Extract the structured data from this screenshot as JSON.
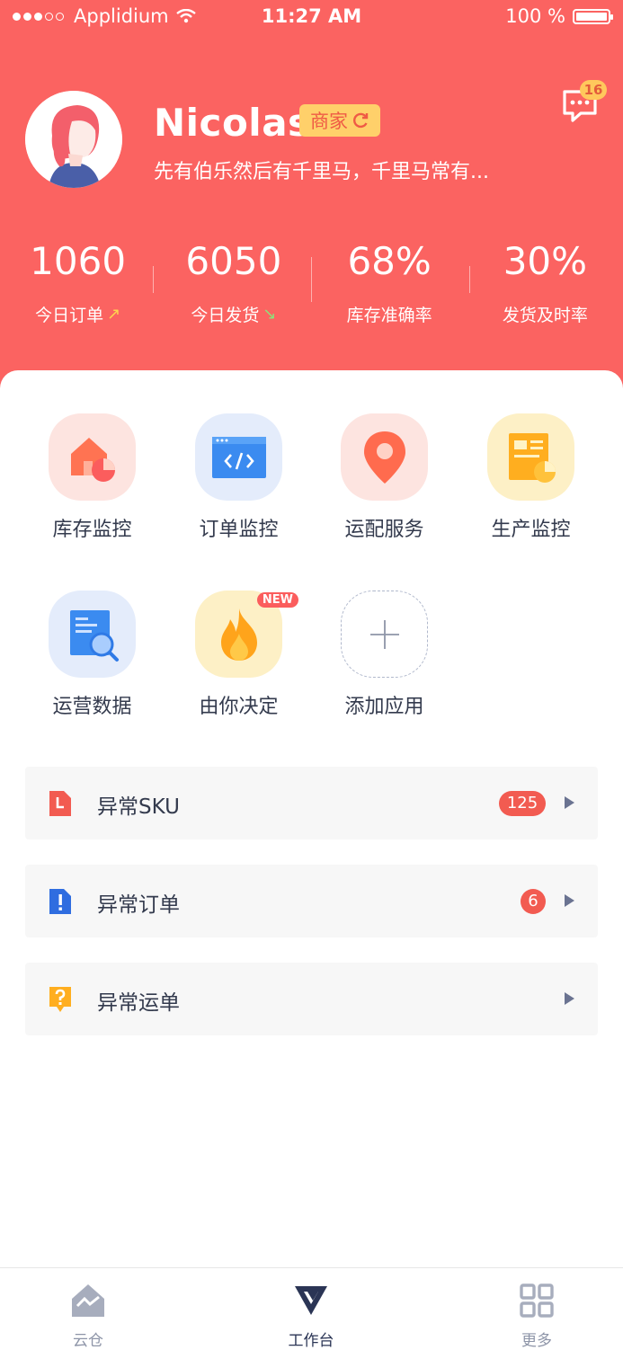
{
  "status_bar": {
    "carrier": "Applidium",
    "time": "11:27 AM",
    "battery": "100 %"
  },
  "profile": {
    "name": "Nicolas",
    "role": "商家",
    "motto": "先有伯乐然后有千里马，千里马常有...",
    "message_count": "16"
  },
  "stats": [
    {
      "value": "1060",
      "label": "今日订单",
      "trend": "up"
    },
    {
      "value": "6050",
      "label": "今日发货",
      "trend": "down"
    },
    {
      "value": "68%",
      "label": "库存准确率"
    },
    {
      "value": "30%",
      "label": "发货及时率"
    }
  ],
  "apps": [
    {
      "label": "库存监控",
      "icon": "warehouse-monitor-icon"
    },
    {
      "label": "订单监控",
      "icon": "order-monitor-icon"
    },
    {
      "label": "运配服务",
      "icon": "location-pin-icon"
    },
    {
      "label": "生产监控",
      "icon": "production-monitor-icon"
    },
    {
      "label": "运营数据",
      "icon": "data-search-icon"
    },
    {
      "label": "由你决定",
      "icon": "flame-icon",
      "badge": "NEW"
    },
    {
      "label": "添加应用",
      "icon": "plus-icon"
    }
  ],
  "alerts": [
    {
      "label": "异常SKU",
      "count": "125",
      "icon": "document-alert-icon"
    },
    {
      "label": "异常订单",
      "count": "6",
      "icon": "exclamation-doc-icon"
    },
    {
      "label": "异常运单",
      "count": "",
      "icon": "question-tag-icon"
    }
  ],
  "tabs": [
    {
      "label": "云仓",
      "active": false
    },
    {
      "label": "工作台",
      "active": true
    },
    {
      "label": "更多",
      "active": false
    }
  ],
  "colors": {
    "primary": "#fb6361",
    "badge_yellow": "#ffd06a",
    "alert_red": "#f25b51",
    "nav_dark": "#2b3555"
  }
}
